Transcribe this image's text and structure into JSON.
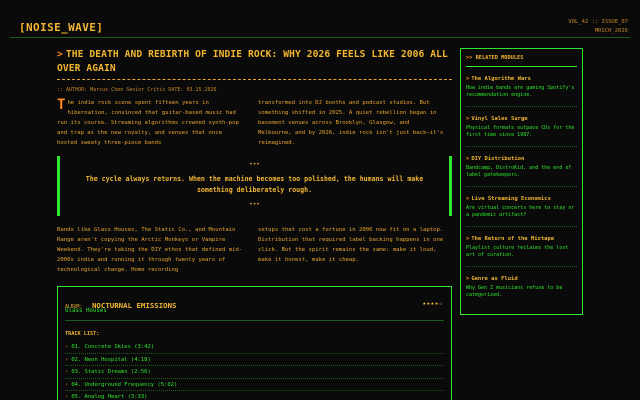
{
  "site": {
    "logo": "[NOISE_WAVE]",
    "meta_line1": "VOL_42 :: ISSUE_07",
    "meta_line2": "MRSCH_2026"
  },
  "article": {
    "arrow": ">",
    "title": "THE DEATH AND REBIRTH OF INDIE ROCK: WHY 2026 FEELS LIKE 2006 ALL OVER AGAIN",
    "byline": "::  AUTHOR: Marcus Chen  Senior Critic  DATE: 03.15.2026",
    "dropcap": "T",
    "para1_left": "he indie rock scene spent fifteen years in hibernation, convinced that guitar-based music had run its course. Streaming algorithms crowned synth-pop and trap as the new royalty, and venues that once hosted sweaty three-piece bands",
    "para1_right": "transformed into DJ booths and podcast studios. But something shifted in 2025. A quiet rebellion began in basement venues across Brooklyn, Glasgow, and Melbourne, and by 2026, indie rock isn't just back—it's reimagined.",
    "quote_dots": "•••",
    "quote": "The cycle always returns. When the machine becomes too polished, the humans will make something deliberately rough.",
    "para2_left": "Bands like Glass Houses, The Static Co., and Mountain Range aren't copying the Arctic Monkeys or Vampire Weekend. They're taking the DIY ethos that defined mid-2000s indie and running it through twenty years of technological change. Home recording",
    "para2_right": "setups that cost a fortune in 2006 now fit on a laptop. Distribution that required label backing happens in one click. But the spirit remains the same: make it loud, make it honest, make it cheap."
  },
  "album": {
    "label": "ALBUM:",
    "title": "NOCTURNAL EMISSIONS",
    "artist": "Glass Houses",
    "rating_stars": "★★★★☆",
    "tracklist_label": "TRACK LIST:",
    "bullet": "›",
    "tracks": [
      "01. Concrete Skies (3:42)",
      "02. Neon Hospital (4:18)",
      "03. Static Dreams (2:56)",
      "04. Underground Frequency (5:02)",
      "05. Analog Heart (3:33)"
    ]
  },
  "sidebar": {
    "heading_arrow": ">>",
    "heading": "RELATED MODULES",
    "item_arrow": ">",
    "items": [
      {
        "title": "The Algorithm Wars",
        "desc": "How indie bands are gaming Spotify's recommendation engine."
      },
      {
        "title": "Vinyl Sales Surge",
        "desc": "Physical formats outpace CDs for the first time since 1987."
      },
      {
        "title": "DIY Distribution",
        "desc": "Bandcamp, DistroKid, and the end of label gatekeepers."
      },
      {
        "title": "Live Streaming Economics",
        "desc": "Are virtual concerts here to stay or a pandemic artifact?"
      },
      {
        "title": "The Return of the Mixtape",
        "desc": "Playlist culture reclaims the lost art of curation."
      },
      {
        "title": "Genre as Fluid",
        "desc": "Why Gen Z musicians refuse to be categorized."
      }
    ]
  },
  "colors": {
    "amber": "#e6a530",
    "green": "#2ee62e",
    "orange": "#ff8a1e",
    "background": "#0a0a0a"
  }
}
